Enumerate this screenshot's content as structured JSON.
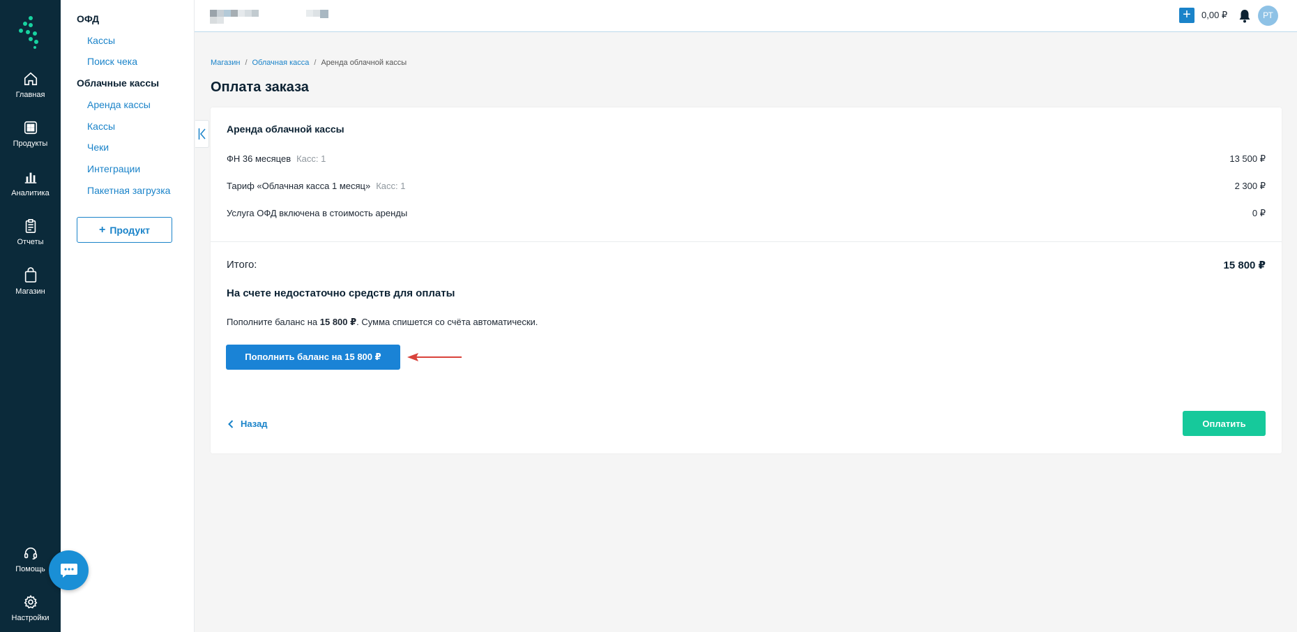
{
  "rail": {
    "items": [
      {
        "label": "Главная",
        "icon": "home-icon"
      },
      {
        "label": "Продукты",
        "icon": "grid-icon"
      },
      {
        "label": "Аналитика",
        "icon": "bar-chart-icon"
      },
      {
        "label": "Отчеты",
        "icon": "clipboard-icon"
      },
      {
        "label": "Магазин",
        "icon": "shopping-bag-icon"
      }
    ],
    "bottom": [
      {
        "label": "Помощь",
        "icon": "headset-icon"
      },
      {
        "label": "Настройки",
        "icon": "gear-icon"
      }
    ]
  },
  "subnav": {
    "group1": "ОФД",
    "group1_links": [
      "Кассы",
      "Поиск чека"
    ],
    "group2": "Облачные кассы",
    "group2_links": [
      "Аренда кассы",
      "Кассы",
      "Чеки",
      "Интеграции",
      "Пакетная загрузка"
    ],
    "add_product": "Продукт"
  },
  "topbar": {
    "balance": "0,00 ₽",
    "avatar_initials": "РТ"
  },
  "breadcrumb": [
    "Магазин",
    "Облачная касса",
    "Аренда облачной кассы"
  ],
  "page_title": "Оплата заказа",
  "order": {
    "title": "Аренда облачной кассы",
    "lines": [
      {
        "name": "ФН 36 месяцев",
        "qty": "Касс: 1",
        "price": "13 500 ₽"
      },
      {
        "name": "Тариф «Облачная касса 1 месяц»",
        "qty": "Касс: 1",
        "price": "2 300 ₽"
      },
      {
        "name": "Услуга ОФД включена в стоимость аренды",
        "qty": "",
        "price": "0 ₽"
      }
    ],
    "total_label": "Итого:",
    "total_value": "15 800 ₽",
    "warning_title": "На счете недостаточно средств для оплаты",
    "warning_prefix": "Пополните баланс на ",
    "warning_amount": "15 800 ₽",
    "warning_suffix": ". Сумма спишется со счёта автоматически.",
    "topup_button": "Пополнить баланс на 15 800 ₽",
    "back_button": "Назад",
    "pay_button": "Оплатить"
  },
  "colors": {
    "rail_bg": "#0b2a3a",
    "accent_blue": "#1a83c9",
    "pay_green": "#16c99b",
    "annotation_red": "#d9433b"
  }
}
